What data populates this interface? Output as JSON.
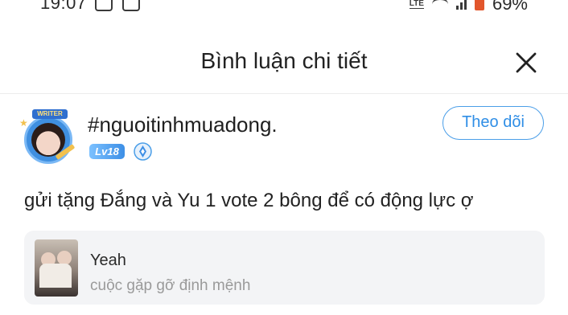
{
  "status_bar": {
    "time": "19:07",
    "network": "LTE",
    "battery": "69%"
  },
  "header": {
    "title": "Bình luận chi tiết"
  },
  "comment": {
    "username": "#nguoitinhmuadong.",
    "level": "Lv18",
    "frame_badge": "WRITER",
    "follow_label": "Theo dõi",
    "text": "gửi tặng Đắng và Yu 1 vote 2 bông để có động lực ợ"
  },
  "quoted_item": {
    "title": "Yeah",
    "subtitle": "cuộc gặp gỡ định mệnh"
  },
  "icons": {
    "close": "close-icon",
    "verify": "verified-badge-icon",
    "wifi": "wifi-icon",
    "signal": "signal-icon",
    "battery": "battery-icon"
  },
  "colors": {
    "accent": "#2f8ee6",
    "level_badge": "#4a9ee8",
    "card_bg": "#f3f4f6",
    "subtitle_text": "#9a9a9a"
  }
}
